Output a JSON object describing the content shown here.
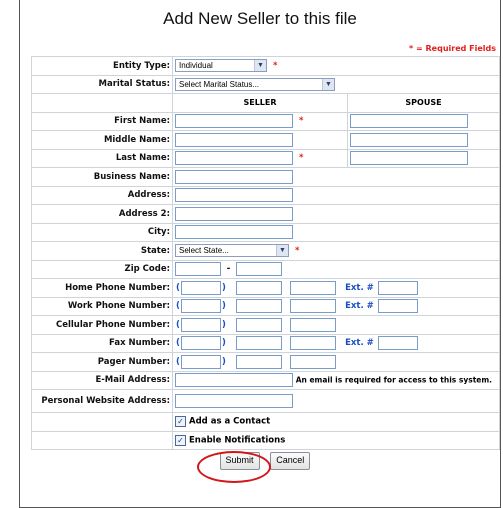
{
  "title": "Add New Seller to this file",
  "required_note": "* = Required Fields",
  "required_star": "*",
  "labels": {
    "entity_type": "Entity Type:",
    "marital_status": "Marital Status:",
    "first_name": "First Name:",
    "middle_name": "Middle Name:",
    "last_name": "Last Name:",
    "business_name": "Business Name:",
    "address": "Address:",
    "address2": "Address 2:",
    "city": "City:",
    "state": "State:",
    "zip": "Zip Code:",
    "home_phone": "Home Phone Number:",
    "work_phone": "Work Phone Number:",
    "cell_phone": "Cellular Phone Number:",
    "fax": "Fax Number:",
    "pager": "Pager Number:",
    "email": "E-Mail Address:",
    "website": "Personal Website Address:"
  },
  "columns": {
    "seller": "SELLER",
    "spouse": "SPOUSE"
  },
  "selects": {
    "entity_type": "Individual",
    "marital_status": "Select Marital Status...",
    "state": "Select State..."
  },
  "phone": {
    "open": "(",
    "close": ")",
    "ext": "Ext. #",
    "zip_sep": "-"
  },
  "email_note": "An email is required for access to this system.",
  "checkboxes": {
    "add_contact": "Add as a Contact",
    "enable_notifications": "Enable Notifications",
    "check_mark": "✓"
  },
  "buttons": {
    "submit": "Submit",
    "cancel": "Cancel"
  },
  "colors": {
    "required": "#e0201c",
    "link_blue": "#1a4ec2",
    "highlight_circle": "#d2161b"
  }
}
